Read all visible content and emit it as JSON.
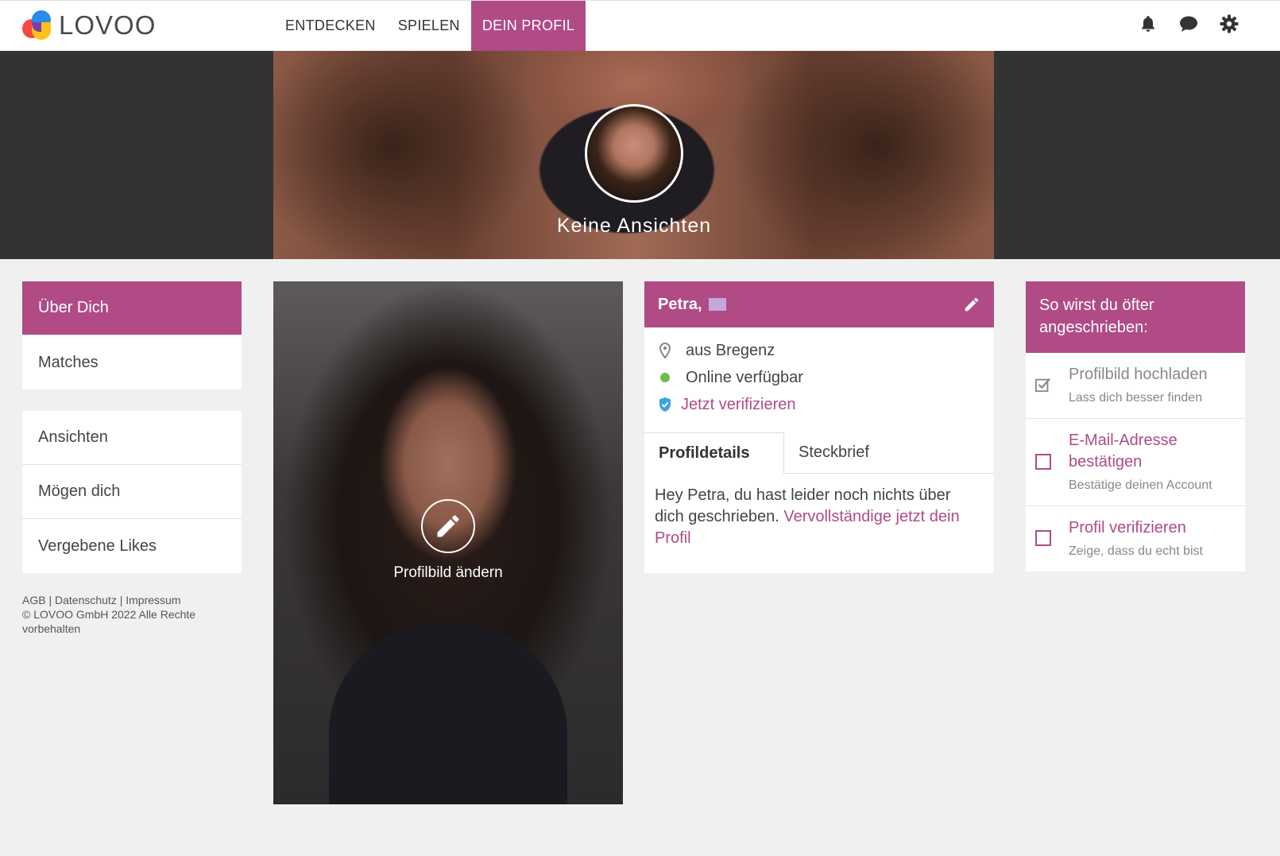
{
  "brand": {
    "name": "LOVOO"
  },
  "nav": {
    "items": [
      {
        "label": "ENTDECKEN"
      },
      {
        "label": "SPIELEN"
      },
      {
        "label": "DEIN PROFIL"
      }
    ]
  },
  "top_icons": [
    "bell-icon",
    "chat-icon",
    "gear-icon"
  ],
  "hero": {
    "views_label": "Keine Ansichten"
  },
  "sidebar": {
    "group1": [
      {
        "label": "Über Dich"
      },
      {
        "label": "Matches"
      }
    ],
    "group2": [
      {
        "label": "Ansichten"
      },
      {
        "label": "Mögen dich"
      },
      {
        "label": "Vergebene Likes"
      }
    ],
    "footer": {
      "agb": "AGB",
      "datenschutz": "Datenschutz",
      "impressum": "Impressum",
      "copyright": "© LOVOO GmbH 2022 Alle Rechte vorbehalten"
    }
  },
  "photo": {
    "edit_label": "Profilbild ändern"
  },
  "profile": {
    "name": "Petra,",
    "location": "aus Bregenz",
    "status": "Online verfügbar",
    "verify": "Jetzt verifizieren",
    "tabs": [
      {
        "label": "Profildetails"
      },
      {
        "label": "Steckbrief"
      }
    ],
    "empty_text": "Hey Petra, du hast leider noch nichts über dich geschrieben.",
    "empty_link": "Vervollständige jetzt dein Profil",
    "colors": {
      "accent": "#b04b86",
      "online": "#6cbf4a",
      "verify": "#3aa3e3"
    }
  },
  "tips": {
    "title": "So wirst du öfter angeschrieben:",
    "items": [
      {
        "title": "Profilbild hochladen",
        "sub": "Lass dich besser finden",
        "done": true
      },
      {
        "title": "E-Mail-Adresse bestätigen",
        "sub": "Bestätige deinen Account",
        "done": false
      },
      {
        "title": "Profil verifizieren",
        "sub": "Zeige, dass du echt bist",
        "done": false
      }
    ]
  }
}
